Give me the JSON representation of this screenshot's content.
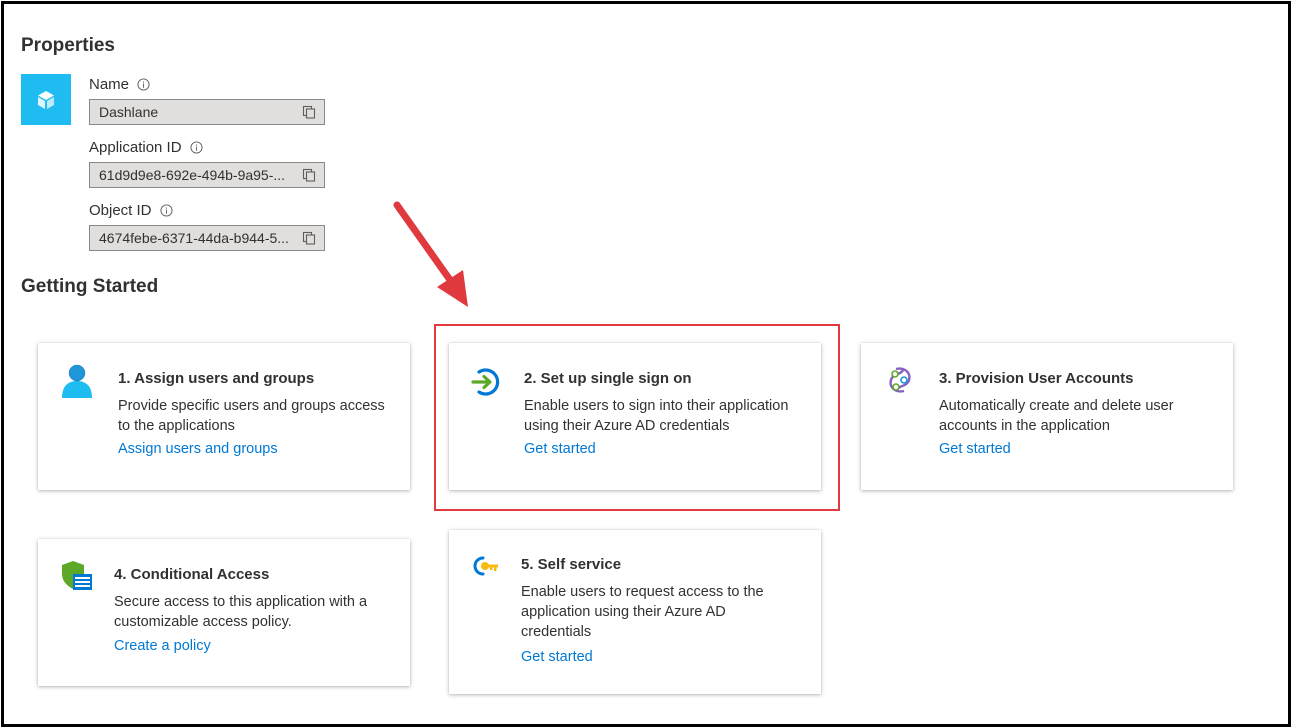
{
  "properties": {
    "title": "Properties",
    "fields": [
      {
        "label": "Name",
        "value": "Dashlane"
      },
      {
        "label": "Application ID",
        "value": "61d9d9e8-692e-494b-9a95-..."
      },
      {
        "label": "Object ID",
        "value": "4674febe-6371-44da-b944-5..."
      }
    ]
  },
  "getting_started": {
    "title": "Getting Started",
    "cards": [
      {
        "title": "1. Assign users and groups",
        "description": "Provide specific users and groups access to the applications",
        "link": "Assign users and groups"
      },
      {
        "title": "2. Set up single sign on",
        "description": "Enable users to sign into their application using their Azure AD credentials",
        "link": "Get started"
      },
      {
        "title": "3. Provision User Accounts",
        "description": "Automatically create and delete user accounts in the application",
        "link": "Get started"
      },
      {
        "title": "4. Conditional Access",
        "description": "Secure access to this application with a customizable access policy.",
        "link": "Create a policy"
      },
      {
        "title": "5. Self service",
        "description": "Enable users to request access to the application using their Azure AD credentials",
        "link": "Get started"
      }
    ]
  },
  "colors": {
    "accent_link": "#0078d4",
    "app_icon_bg": "#1ebcf0",
    "annotation_red": "#e0393e"
  },
  "icons": {
    "app": "cube-icon",
    "card1": "user-icon",
    "card2": "sign-in-arrow-icon",
    "card3": "provisioning-icon",
    "card4": "shield-policy-icon",
    "card5": "key-icon"
  }
}
